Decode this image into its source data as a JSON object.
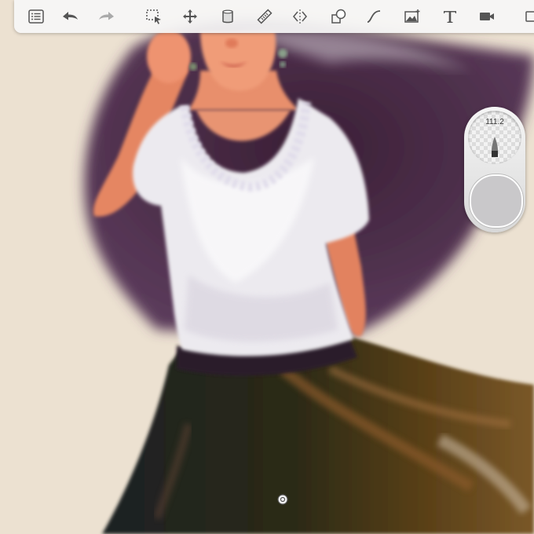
{
  "toolbar": {
    "tools": [
      "list-icon",
      "undo-icon",
      "redo-icon",
      "selection-icon",
      "transform-icon",
      "layer-icon",
      "ruler-icon",
      "symmetry-icon",
      "shapes-icon",
      "curve-icon",
      "import-image-icon",
      "text-icon",
      "record-icon",
      "fullscreen-icon"
    ]
  },
  "brush_puck": {
    "size": "111.2",
    "color": "#c9c8ca"
  },
  "canvas": {
    "background": "#ece1d1"
  }
}
